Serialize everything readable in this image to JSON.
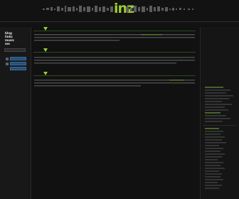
{
  "header": {
    "logo_text": "inz",
    "accent_color": "#9acd32"
  },
  "sidebar": {
    "items": [
      {
        "label": "blog"
      },
      {
        "label": "links"
      },
      {
        "label": "music"
      },
      {
        "label": "me"
      }
    ]
  },
  "posts": [
    {
      "title": "...",
      "icon": "triangle-icon"
    },
    {
      "title": "...",
      "icon": "triangle-icon"
    },
    {
      "title": "...",
      "icon": "triangle-icon"
    }
  ],
  "colors": {
    "background": "#111111",
    "accent": "#9acd32",
    "text": "#8c8c8c",
    "link": "#e6e6e6",
    "button": "#264f78"
  }
}
